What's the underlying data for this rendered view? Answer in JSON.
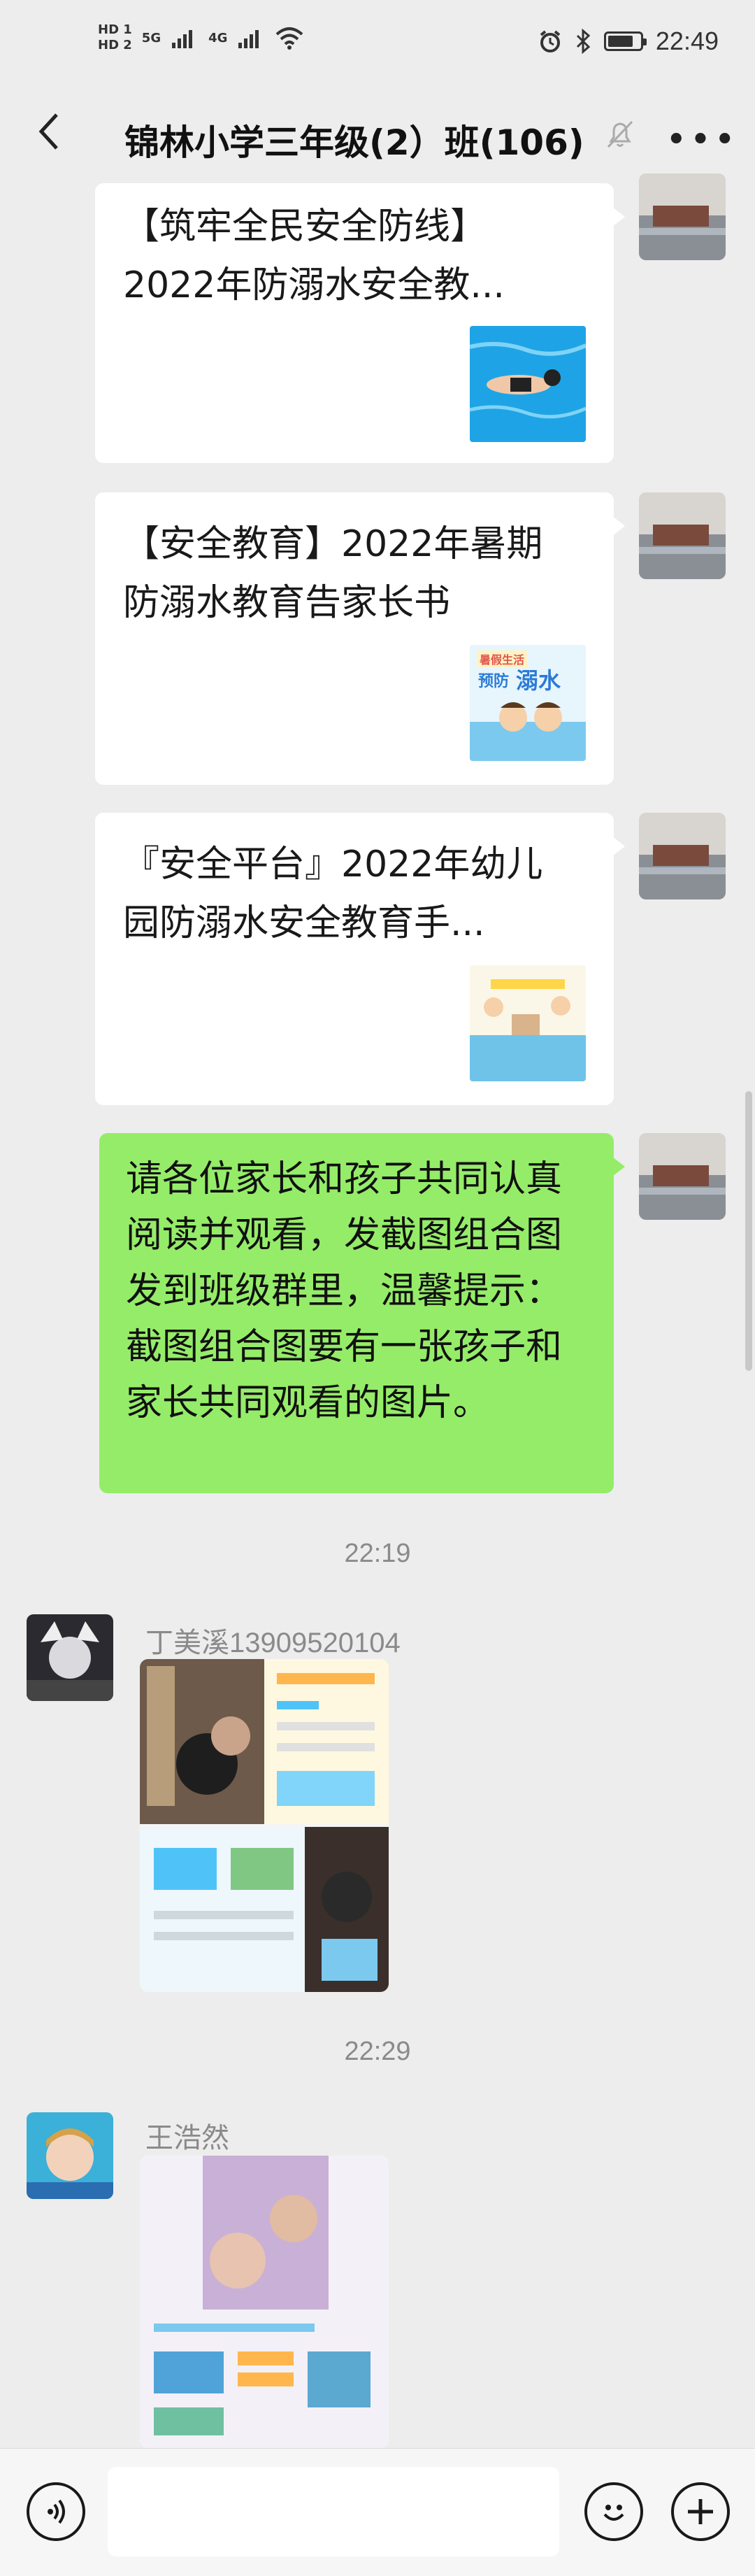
{
  "status": {
    "hd1": "HD 1",
    "hd2": "HD 2",
    "net1": "5G",
    "net2": "4G",
    "time": "22:49"
  },
  "header": {
    "title": "锦林小学三年级(2）班(106)"
  },
  "messages": {
    "card1_text": "【筑牢全民安全防线】2022年防溺水安全教...",
    "card2_text": "【安全教育】2022年暑期防溺水教育告家长书",
    "card3_text": "『安全平台』2022年幼儿园防溺水安全教育手...",
    "card2_thumb_line1": "暑假生活",
    "card2_thumb_line2": "预防",
    "card2_thumb_line3": "溺水",
    "green_text": "请各位家长和孩子共同认真阅读并观看，发截图组合图发到班级群里，温馨提示：截图组合图要有一张孩子和家长共同观看的图片。",
    "time1": "22:19",
    "sender1": "丁美溪13909520104",
    "time2": "22:29",
    "sender2": "王浩然"
  },
  "input": {
    "placeholder": ""
  }
}
